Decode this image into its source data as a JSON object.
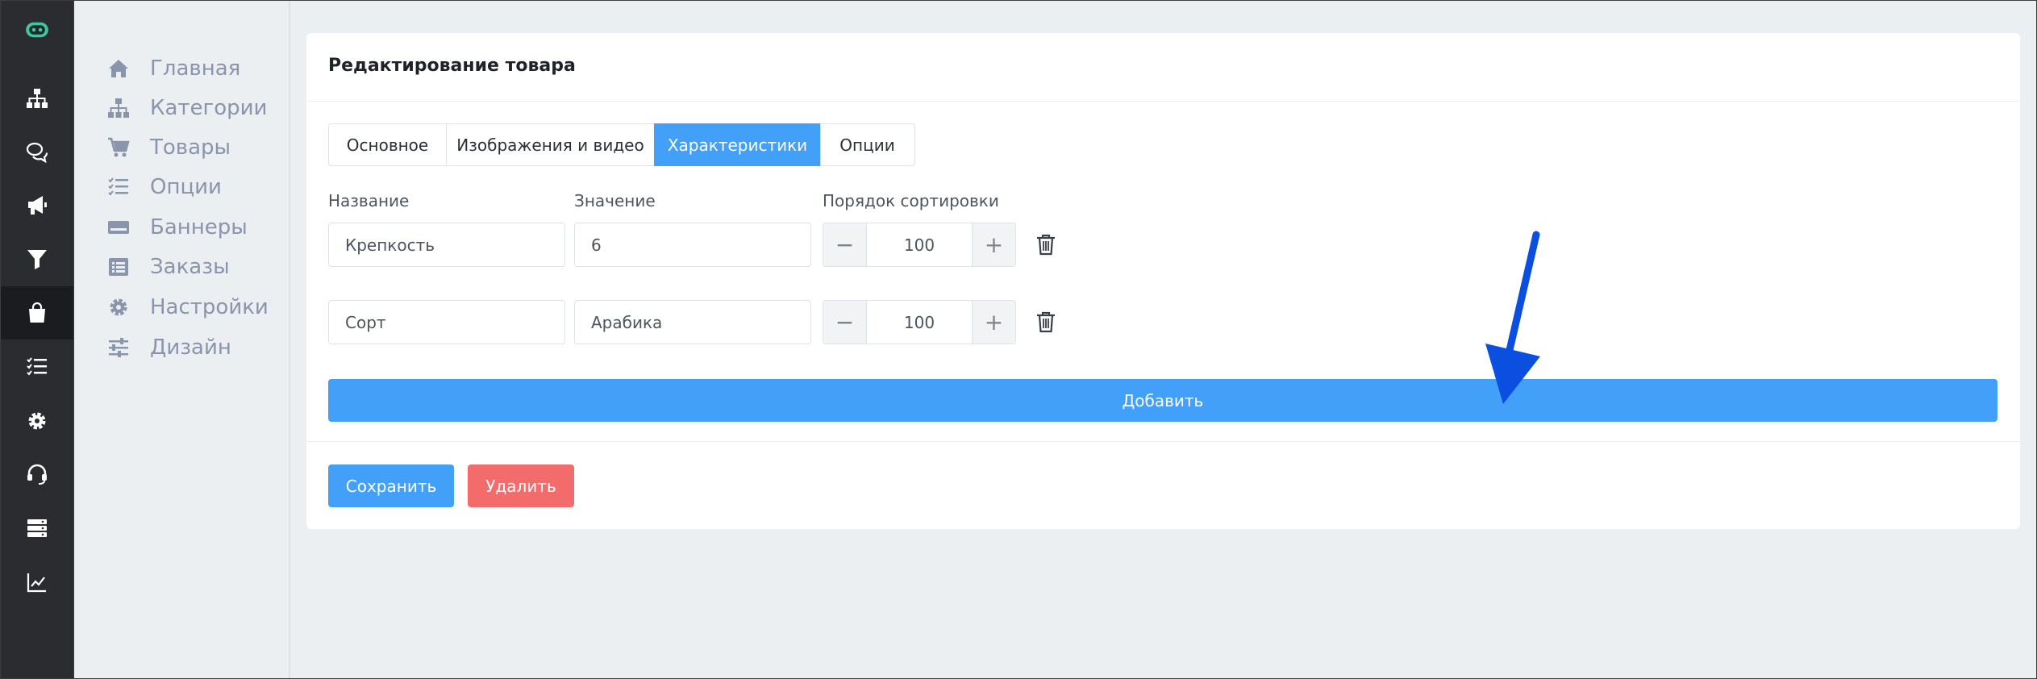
{
  "rail": {
    "items": [
      {
        "icon": "sitemap-icon"
      },
      {
        "icon": "chat-icon"
      },
      {
        "icon": "megaphone-icon"
      },
      {
        "icon": "filter-icon"
      },
      {
        "icon": "shopping-bag-icon",
        "active": true
      },
      {
        "icon": "checklist-icon"
      },
      {
        "icon": "gear-icon"
      },
      {
        "icon": "headset-icon"
      },
      {
        "icon": "server-icon"
      },
      {
        "icon": "chart-icon"
      }
    ]
  },
  "nav": {
    "items": [
      {
        "label": "Главная",
        "icon": "home-icon"
      },
      {
        "label": "Категории",
        "icon": "sitemap-icon"
      },
      {
        "label": "Товары",
        "icon": "cart-icon"
      },
      {
        "label": "Опции",
        "icon": "checklist-icon"
      },
      {
        "label": "Баннеры",
        "icon": "banner-icon"
      },
      {
        "label": "Заказы",
        "icon": "list-icon"
      },
      {
        "label": "Настройки",
        "icon": "gear-icon"
      },
      {
        "label": "Дизайн",
        "icon": "sliders-icon"
      }
    ]
  },
  "card": {
    "title": "Редактирование товара",
    "tabs": [
      {
        "label": "Основное"
      },
      {
        "label": "Изображения и видео"
      },
      {
        "label": "Характеристики",
        "active": true
      },
      {
        "label": "Опции"
      }
    ],
    "columns": {
      "name": "Название",
      "value": "Значение",
      "sort": "Порядок сортировки"
    },
    "rows": [
      {
        "name": "Крепкость",
        "value": "6",
        "sort": "100"
      },
      {
        "name": "Сорт",
        "value": "Арабика",
        "sort": "100"
      }
    ],
    "stepper": {
      "minus": "−",
      "plus": "+"
    },
    "add_label": "Добавить",
    "save_label": "Сохранить",
    "delete_label": "Удалить"
  },
  "colors": {
    "primary": "#42a0f8",
    "danger": "#f26c6c",
    "rail_bg": "#2a2c30",
    "annotation_arrow": "#0b4fe0"
  }
}
